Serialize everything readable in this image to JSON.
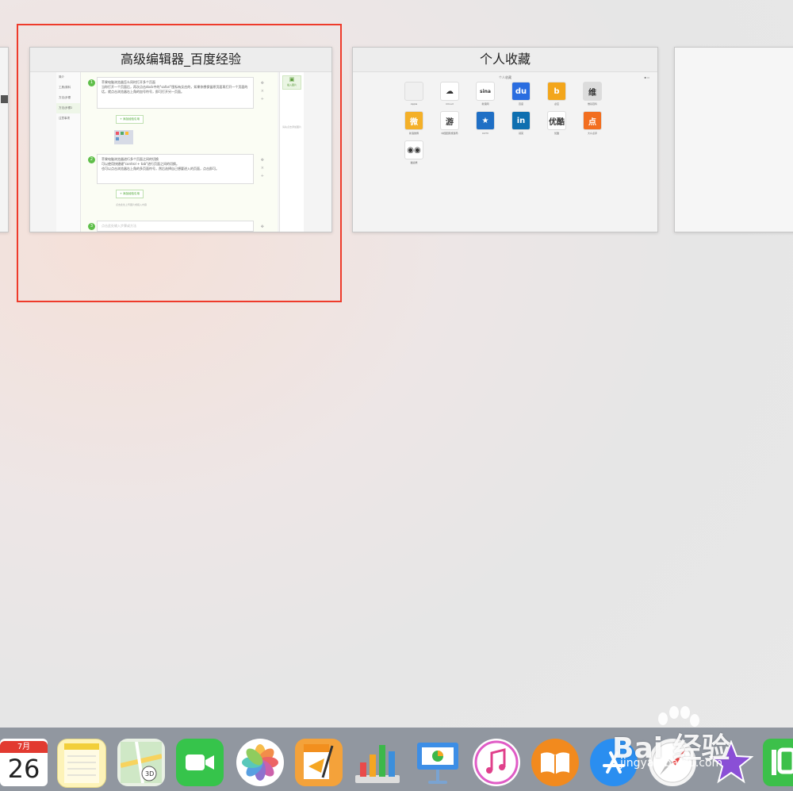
{
  "windows": {
    "editor": {
      "title": "高级编辑器_百度经验",
      "nav": [
        "简介",
        "工具/原料",
        "方法/步骤",
        "方法/步骤2",
        "注意事项"
      ],
      "steps": [
        {
          "num": "1",
          "text": "苹果电脑浏览器怎么同时打开多个页面\n当你打开一个页面后，再次点击dock中的\"safari\"图标有反应的，如果你想保留原页面再打开一个页面的话，就点击浏览器右上角的加号符号，即可打开另一页面。"
        },
        {
          "num": "2",
          "text": "苹果电脑浏览器进行多个页面之间的切换\n可以使用快捷键\"control + tab\"进行页面之间的切换。\n也可以点击浏览器右上角的多页面符号，然后选择自己想要进入的页面，点击即可。"
        },
        {
          "num": "3",
          "text": "点击此处输入步骤或方法"
        }
      ],
      "add_button": "+ 添加经验引用",
      "insert_image": "插入图片",
      "right_hint": "请先点击添加图片",
      "upload_hint": "点击此处上传图片或拖入内容"
    },
    "favorites": {
      "title": "个人收藏",
      "header": "个人收藏",
      "items": [
        {
          "label": "Apple",
          "icon": "apple-icon",
          "color": "#f0f0f0",
          "glyph": ""
        },
        {
          "label": "iCloud",
          "icon": "icloud-icon",
          "color": "#ffffff",
          "glyph": "☁"
        },
        {
          "label": "新浪网",
          "icon": "sina-icon",
          "color": "#ffffff",
          "glyph": "sina"
        },
        {
          "label": "百度",
          "icon": "baidu-icon",
          "color": "#2a6de0",
          "glyph": "du"
        },
        {
          "label": "必应",
          "icon": "bing-icon",
          "color": "#f3a61b",
          "glyph": "b"
        },
        {
          "label": "维基百科",
          "icon": "wikipedia-icon",
          "color": "#dcdcdc",
          "glyph": "维"
        },
        {
          "label": "新浪微博",
          "icon": "weibo-icon",
          "color": "#f4b028",
          "glyph": "微"
        },
        {
          "label": "中国国家旅游局",
          "icon": "tourism-icon",
          "color": "#ffffff",
          "glyph": "游"
        },
        {
          "label": "CCTV",
          "icon": "cctv-icon",
          "color": "#1f6fc5",
          "glyph": "★"
        },
        {
          "label": "领英",
          "icon": "linkedin-icon",
          "color": "#0e6fb0",
          "glyph": "in"
        },
        {
          "label": "优酷",
          "icon": "youku-icon",
          "color": "#ffffff",
          "glyph": "优酷"
        },
        {
          "label": "大众点评",
          "icon": "dianping-icon",
          "color": "#f26e1f",
          "glyph": "点"
        },
        {
          "label": "猫途鹰",
          "icon": "tripadvisor-icon",
          "color": "#ffffff",
          "glyph": "◉◉"
        }
      ]
    }
  },
  "dock": {
    "calendar_month": "7月",
    "calendar_day": "26",
    "apps": [
      "Calendar",
      "Notes",
      "Maps",
      "FaceTime",
      "Photos",
      "Pages",
      "Numbers",
      "Keynote",
      "iTunes",
      "iBooks",
      "App Store",
      "Safari",
      "iMovie",
      "iQIYI"
    ]
  },
  "watermark": {
    "text": "Bai 经验",
    "url": "jingyan.baidu.com"
  }
}
